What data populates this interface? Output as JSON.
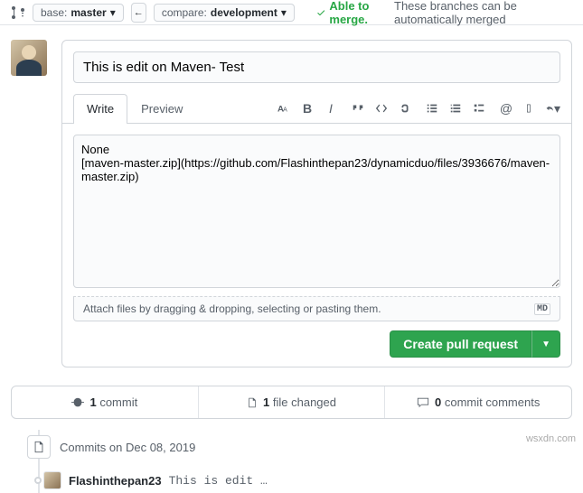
{
  "topbar": {
    "base_label": "base:",
    "base_value": "master",
    "compare_label": "compare:",
    "compare_value": "development",
    "merge_able": "Able to merge.",
    "merge_text": "These branches can be automatically merged"
  },
  "form": {
    "title_value": "This is edit on Maven- Test",
    "tab_write": "Write",
    "tab_preview": "Preview",
    "body_value": "None\n[maven-master.zip](https://github.com/Flashinthepan23/dynamicduo/files/3936676/maven-master.zip)",
    "attach_hint": "Attach files by dragging & dropping, selecting or pasting them.",
    "md_badge": "MD",
    "submit_label": "Create pull request"
  },
  "stats": {
    "commits_n": "1",
    "commits_label": "commit",
    "files_n": "1",
    "files_label": "file changed",
    "comments_n": "0",
    "comments_label": "commit comments"
  },
  "timeline": {
    "date_label": "Commits on Dec 08, 2019",
    "user": "Flashinthepan23",
    "message": "This is edit …"
  },
  "watermark": "wsxdn.com"
}
